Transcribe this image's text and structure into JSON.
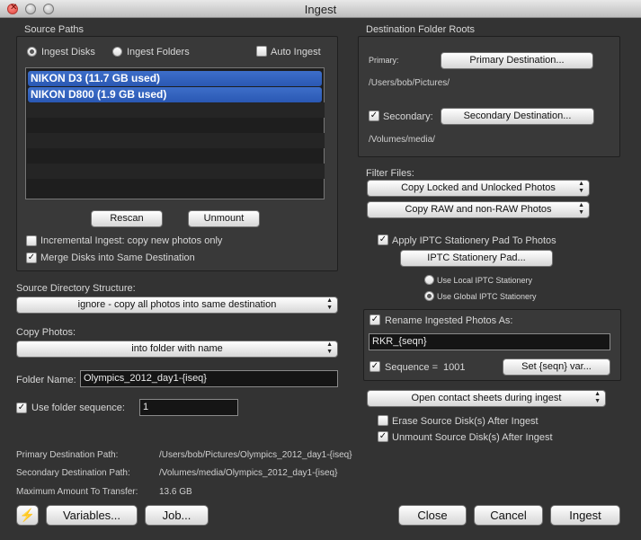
{
  "window": {
    "title": "Ingest"
  },
  "source_paths": {
    "heading": "Source Paths",
    "radio_disks": "Ingest Disks",
    "radio_folders": "Ingest Folders",
    "auto_ingest": "Auto Ingest",
    "disks": [
      {
        "label": "NIKON D3    (11.7 GB used)"
      },
      {
        "label": "NIKON D800   (1.9 GB used)"
      }
    ],
    "rescan_label": "Rescan",
    "unmount_label": "Unmount",
    "incremental_label": "Incremental Ingest: copy new photos only",
    "merge_label": "Merge Disks into Same Destination"
  },
  "destination": {
    "heading": "Destination Folder Roots",
    "primary_label": "Primary:",
    "primary_button": "Primary Destination...",
    "primary_path": "/Users/bob/Pictures/",
    "secondary_label": "Secondary:",
    "secondary_button": "Secondary Destination...",
    "secondary_path": "/Volumes/media/"
  },
  "filter": {
    "heading": "Filter Files:",
    "locked_option": "Copy Locked and Unlocked Photos",
    "raw_option": "Copy RAW and non-RAW Photos"
  },
  "iptc": {
    "apply_label": "Apply IPTC Stationery Pad To Photos",
    "pad_button": "IPTC Stationery Pad...",
    "use_local": "Use Local IPTC Stationery",
    "use_global": "Use Global IPTC Stationery"
  },
  "rename": {
    "label": "Rename Ingested Photos As:",
    "value": "RKR_{seqn}",
    "sequence_label": "Sequence =",
    "sequence_value": "1001",
    "set_var_button": "Set {seqn} var..."
  },
  "contact_sheets": {
    "option": "Open contact sheets during ingest"
  },
  "erase_label": "Erase Source Disk(s) After Ingest",
  "unmount_after_label": "Unmount Source Disk(s) After Ingest",
  "structure": {
    "label": "Source Directory Structure:",
    "option": "ignore - copy all photos into same destination"
  },
  "copy_photos": {
    "label": "Copy Photos:",
    "option": "into folder with name"
  },
  "folder_name": {
    "label": "Folder Name:",
    "value": "Olympics_2012_day1-{iseq}"
  },
  "folder_sequence": {
    "label": "Use folder sequence:",
    "value": "1"
  },
  "summary": {
    "primary_label": "Primary Destination Path:",
    "primary_value": "/Users/bob/Pictures/Olympics_2012_day1-{iseq}",
    "secondary_label": "Secondary Destination Path:",
    "secondary_value": "/Volumes/media/Olympics_2012_day1-{iseq}",
    "max_label": "Maximum Amount To Transfer:",
    "max_value": "13.6 GB"
  },
  "footer": {
    "variables_button": "Variables...",
    "job_button": "Job...",
    "close_button": "Close",
    "cancel_button": "Cancel",
    "ingest_button": "Ingest"
  },
  "icons": {
    "lightning": "lightning-icon"
  }
}
